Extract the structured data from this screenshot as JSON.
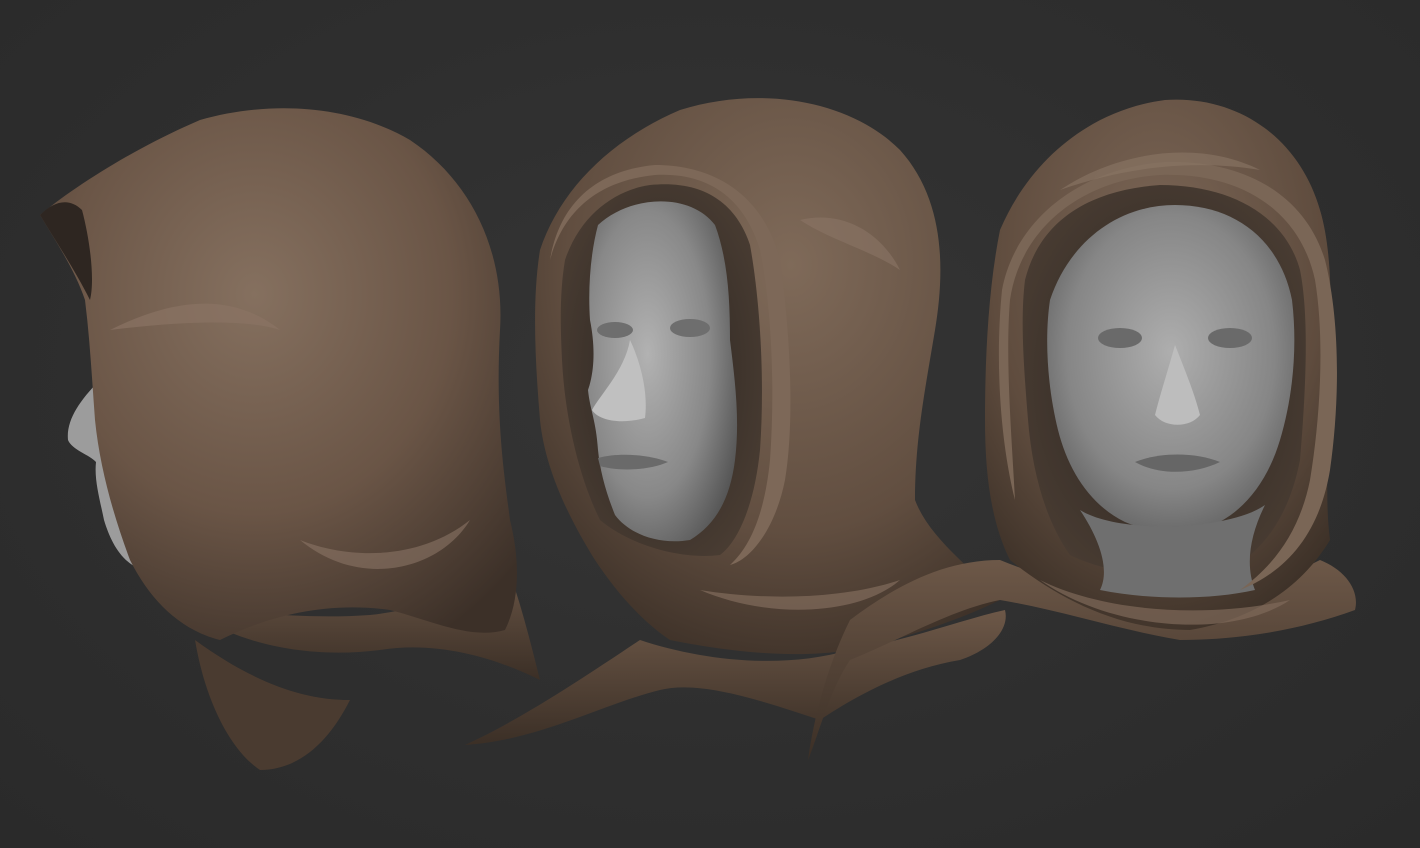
{
  "scene": {
    "background_color": "#2f2f2f",
    "cloth_color": "#6e5a4c",
    "skin_color": "#8f8f8f",
    "views": [
      {
        "name": "side-view",
        "orientation": "profile-left"
      },
      {
        "name": "three-quarter-view",
        "orientation": "three-quarter-left"
      },
      {
        "name": "front-view",
        "orientation": "front"
      }
    ]
  }
}
